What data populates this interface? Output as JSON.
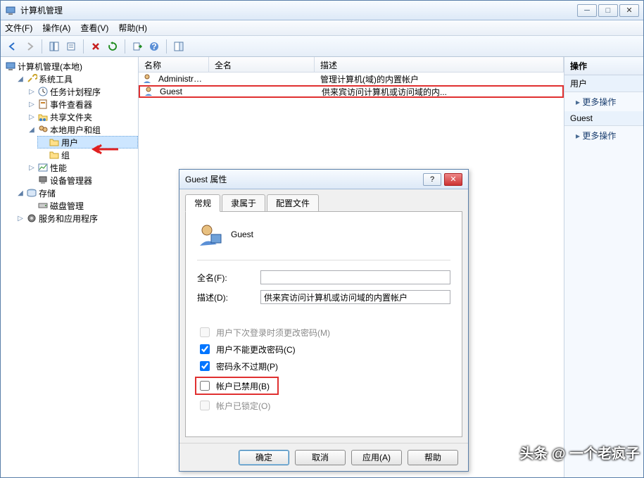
{
  "window": {
    "title": "计算机管理"
  },
  "menu": {
    "file": "文件(F)",
    "action": "操作(A)",
    "view": "查看(V)",
    "help": "帮助(H)"
  },
  "tree": {
    "root": "计算机管理(本地)",
    "sys_tools": "系统工具",
    "task_sched": "任务计划程序",
    "event_viewer": "事件查看器",
    "shared_folders": "共享文件夹",
    "local_users_groups": "本地用户和组",
    "users": "用户",
    "groups": "组",
    "perf": "性能",
    "dev_mgr": "设备管理器",
    "storage": "存储",
    "disk_mgmt": "磁盘管理",
    "services_apps": "服务和应用程序"
  },
  "list": {
    "col_name": "名称",
    "col_full": "全名",
    "col_desc": "描述",
    "rows": [
      {
        "name": "Administrat...",
        "full": "",
        "desc": "管理计算机(域)的内置帐户"
      },
      {
        "name": "Guest",
        "full": "",
        "desc": "供来宾访问计算机或访问域的内..."
      }
    ]
  },
  "actions": {
    "header": "操作",
    "sec1": "用户",
    "more1": "更多操作",
    "sec2": "Guest",
    "more2": "更多操作"
  },
  "dialog": {
    "title": "Guest 属性",
    "tab_general": "常规",
    "tab_memberof": "隶属于",
    "tab_profile": "配置文件",
    "username": "Guest",
    "lbl_fullname": "全名(F):",
    "val_fullname": "",
    "lbl_desc": "描述(D):",
    "val_desc": "供来宾访问计算机或访问域的内置帐户",
    "chk_must_change": "用户下次登录时须更改密码(M)",
    "chk_cannot_change": "用户不能更改密码(C)",
    "chk_never_expire": "密码永不过期(P)",
    "chk_disabled": "帐户已禁用(B)",
    "chk_locked": "帐户已锁定(O)",
    "btn_ok": "确定",
    "btn_cancel": "取消",
    "btn_apply": "应用(A)",
    "btn_help": "帮助"
  },
  "watermark": "头条 @ 一个老疯子"
}
